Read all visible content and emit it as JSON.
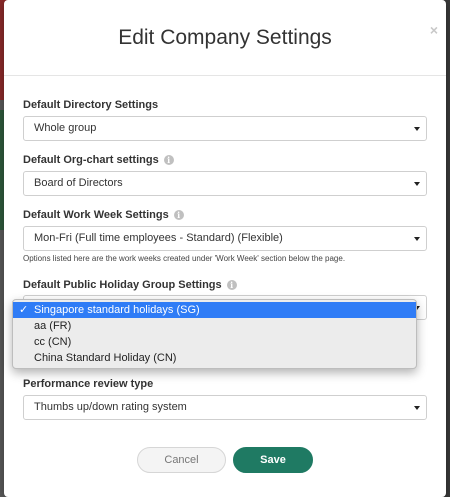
{
  "modal": {
    "title": "Edit Company Settings",
    "close_glyph": "×"
  },
  "fields": {
    "directory": {
      "label": "Default Directory Settings",
      "value": "Whole group"
    },
    "orgchart": {
      "label": "Default Org-chart settings",
      "value": "Board of Directors"
    },
    "workweek": {
      "label": "Default Work Week Settings",
      "value": "Mon-Fri (Full time employees - Standard) (Flexible)",
      "hint": "Options listed here are the work weeks created under 'Work Week' section below the page."
    },
    "holiday": {
      "label": "Default Public Holiday Group Settings"
    },
    "performance": {
      "label": "Performance review type",
      "value": "Thumbs up/down rating system"
    }
  },
  "holiday_dropdown": {
    "options": [
      {
        "label": "Singapore standard holidays (SG)",
        "selected": true
      },
      {
        "label": "aa (FR)",
        "selected": false
      },
      {
        "label": "cc (CN)",
        "selected": false
      },
      {
        "label": "China Standard Holiday (CN)",
        "selected": false
      }
    ],
    "check_glyph": "✓"
  },
  "buttons": {
    "cancel": "Cancel",
    "save": "Save"
  },
  "colors": {
    "primary": "#1f7a63",
    "selection": "#2f7cf6"
  }
}
